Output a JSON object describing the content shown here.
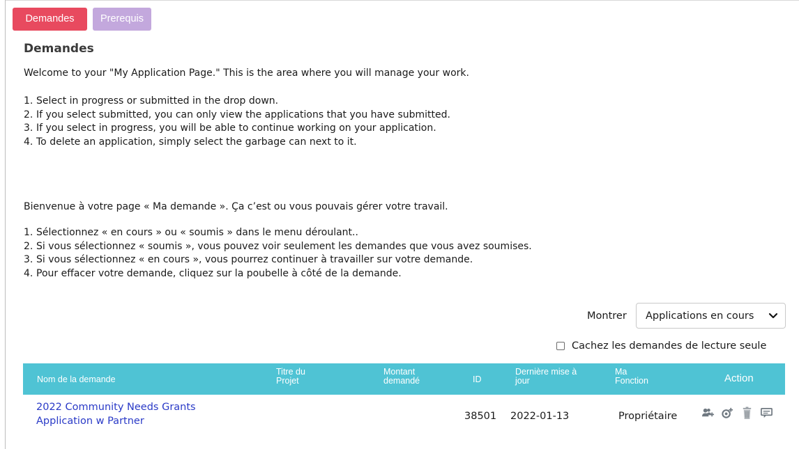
{
  "tabs": [
    {
      "label": "Demandes",
      "active": true
    },
    {
      "label": "Prerequis",
      "active": false
    }
  ],
  "page_title": "Demandes",
  "intro_en": "Welcome to your \"My Application Page.\" This is the area where you will manage your work.",
  "steps_en": [
    "Select in progress or submitted in the drop down.",
    "If you select submitted, you can only view the applications that you have submitted.",
    "If you select in progress, you will be able to continue working on your application.",
    "To delete an application, simply select the garbage can next to it."
  ],
  "intro_fr": "Bienvenue à votre page « Ma demande ». Ça c’est ou vous pouvais gérer votre travail.",
  "steps_fr": [
    "Sélectionnez « en cours » ou « soumis » dans le menu déroulant..",
    "Si vous sélectionnez « soumis », vous pouvez voir seulement les demandes que vous avez soumises.",
    "Si vous sélectionnez « en cours », vous pourrez continuer à travailler sur votre demande.",
    "Pour effacer votre demande, cliquez sur la poubelle à côté de la demande."
  ],
  "filter": {
    "show_label": "Montrer",
    "selected": "Applications en cours",
    "hide_readonly_label": "Cachez les demandes de lecture seule",
    "hide_readonly_checked": false
  },
  "table": {
    "header_color": "#4fc3d4",
    "columns": [
      {
        "line1": "Nom de la demande",
        "line2": ""
      },
      {
        "line1": "Titre du",
        "line2": "Projet"
      },
      {
        "line1": "Montant",
        "line2": "demandé"
      },
      {
        "line1": "ID",
        "line2": ""
      },
      {
        "line1": "Dernière mise à",
        "line2": "jour"
      },
      {
        "line1": "Ma",
        "line2": "Fonction"
      },
      {
        "line1": "Action",
        "line2": ""
      }
    ],
    "rows": [
      {
        "name_line1": "2022 Community Needs Grants",
        "name_line2": "Application w Partner",
        "project_title": "",
        "amount": "",
        "id": "38501",
        "last_updated": "2022-01-13",
        "role": "Propriétaire",
        "actions": [
          "add-users-icon",
          "add-link-icon",
          "trash-icon",
          "comment-icon"
        ]
      }
    ]
  },
  "colors": {
    "tab_active": "#e84a5f",
    "tab_inactive": "#c3a8dd",
    "link": "#2a3ac7"
  }
}
